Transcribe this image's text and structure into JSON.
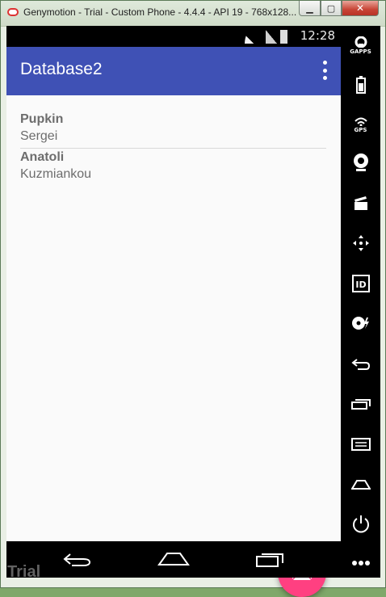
{
  "window": {
    "title": "Genymotion - Trial - Custom Phone - 4.4.4 - API 19 - 768x128...",
    "minimize_glyph": "▁",
    "maximize_glyph": "▢",
    "close_glyph": "✕"
  },
  "statusbar": {
    "time": "12:28"
  },
  "app": {
    "title": "Database2"
  },
  "contacts": [
    {
      "first": "Pupkin",
      "last": "Sergei"
    },
    {
      "first": "Anatoli",
      "last": "Kuzmiankou"
    }
  ],
  "fab": {
    "icon": "mail-icon",
    "color": "#ff4081"
  },
  "toolbar": {
    "gapps_label": "GAPPS",
    "gps_label": "GPS",
    "id_label": "ID"
  },
  "watermark": "Trial",
  "colors": {
    "primary": "#3f51b5",
    "accent": "#ff4081"
  }
}
